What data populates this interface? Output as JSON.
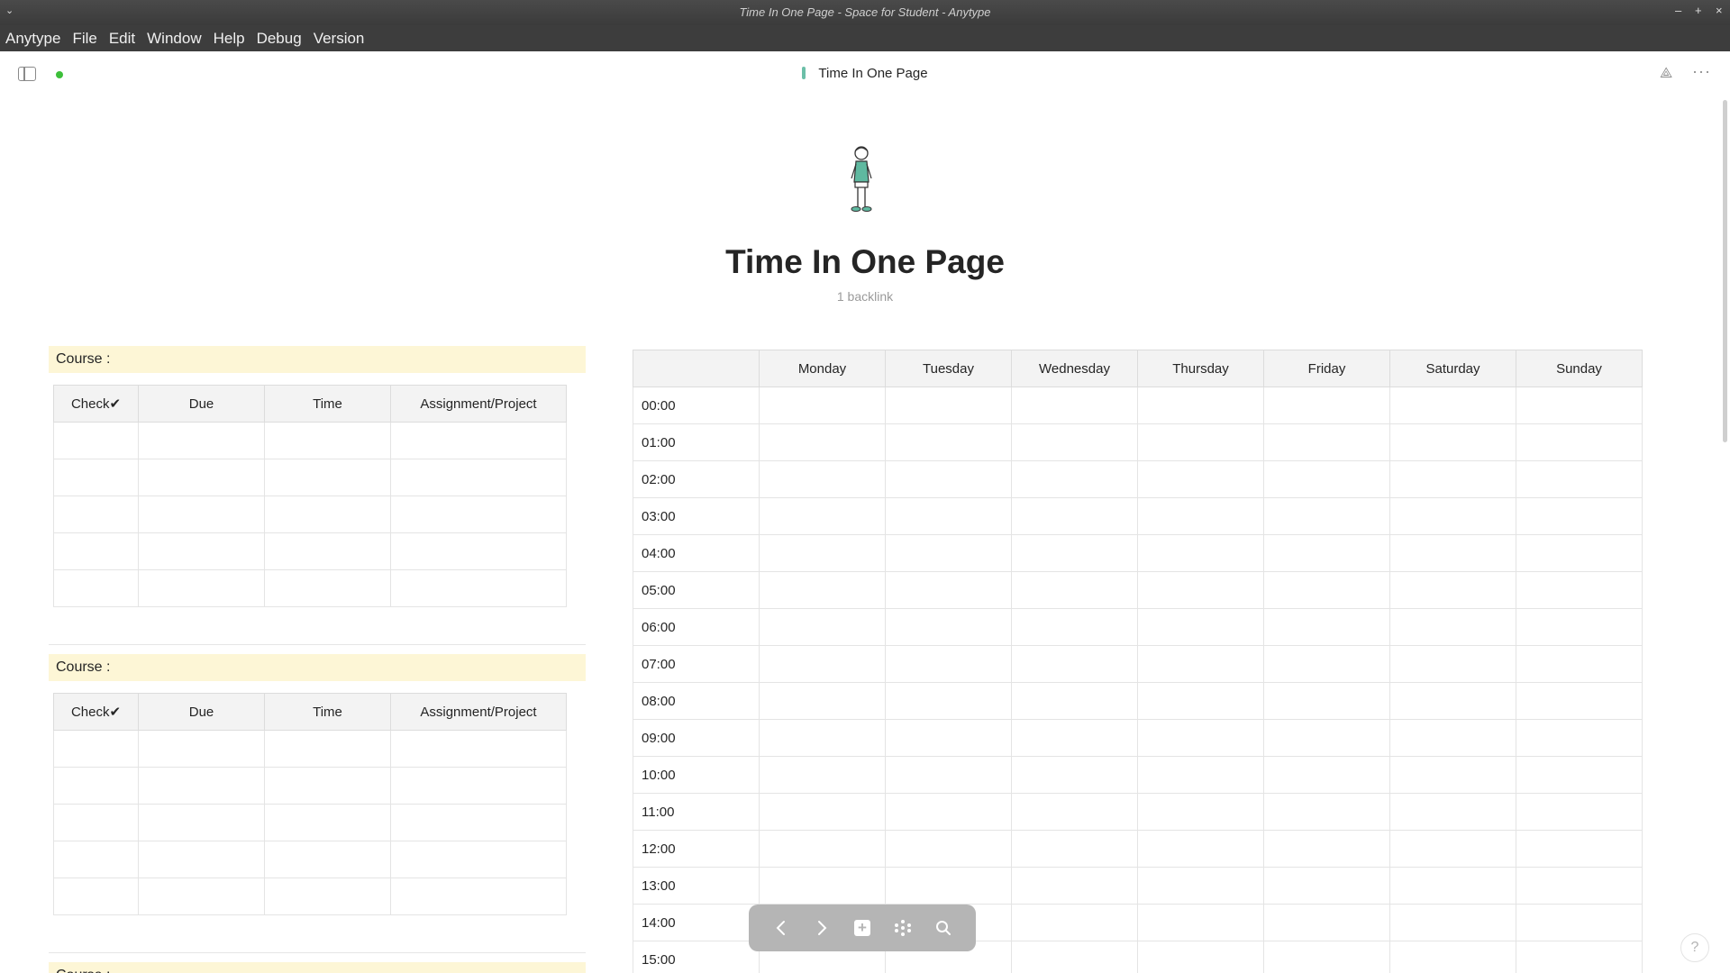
{
  "window": {
    "title": "Time In One Page - Space for Student - Anytype",
    "controls": [
      "–",
      "+",
      "×"
    ]
  },
  "menubar": {
    "items": [
      "Anytype",
      "File",
      "Edit",
      "Window",
      "Help",
      "Debug",
      "Version"
    ]
  },
  "header": {
    "breadcrumb_title": "Time In One Page"
  },
  "page": {
    "title": "Time In One Page",
    "backlinks": "1 backlink"
  },
  "courses": [
    {
      "label": "Course :",
      "columns": [
        "Check✔",
        "Due",
        "Time",
        "Assignment/Project"
      ],
      "rows": [
        [
          "",
          "",
          "",
          ""
        ],
        [
          "",
          "",
          "",
          ""
        ],
        [
          "",
          "",
          "",
          ""
        ],
        [
          "",
          "",
          "",
          ""
        ],
        [
          "",
          "",
          "",
          ""
        ]
      ]
    },
    {
      "label": "Course :",
      "columns": [
        "Check✔",
        "Due",
        "Time",
        "Assignment/Project"
      ],
      "rows": [
        [
          "",
          "",
          "",
          ""
        ],
        [
          "",
          "",
          "",
          ""
        ],
        [
          "",
          "",
          "",
          ""
        ],
        [
          "",
          "",
          "",
          ""
        ],
        [
          "",
          "",
          "",
          ""
        ]
      ]
    },
    {
      "label": "Course :",
      "columns": [],
      "rows": []
    }
  ],
  "timetable": {
    "days": [
      "Monday",
      "Tuesday",
      "Wednesday",
      "Thursday",
      "Friday",
      "Saturday",
      "Sunday"
    ],
    "hours": [
      "00:00",
      "01:00",
      "02:00",
      "03:00",
      "04:00",
      "05:00",
      "06:00",
      "07:00",
      "08:00",
      "09:00",
      "10:00",
      "11:00",
      "12:00",
      "13:00",
      "14:00",
      "15:00"
    ]
  },
  "bottom_nav": {
    "icons": [
      "back-icon",
      "forward-icon",
      "plus-icon",
      "graph-icon",
      "search-icon"
    ]
  },
  "help": {
    "label": "?"
  },
  "colors": {
    "course_header_bg": "#fdf6d6",
    "sync_status": "#3dbf3a",
    "menubar_bg": "#3d3d3d"
  }
}
